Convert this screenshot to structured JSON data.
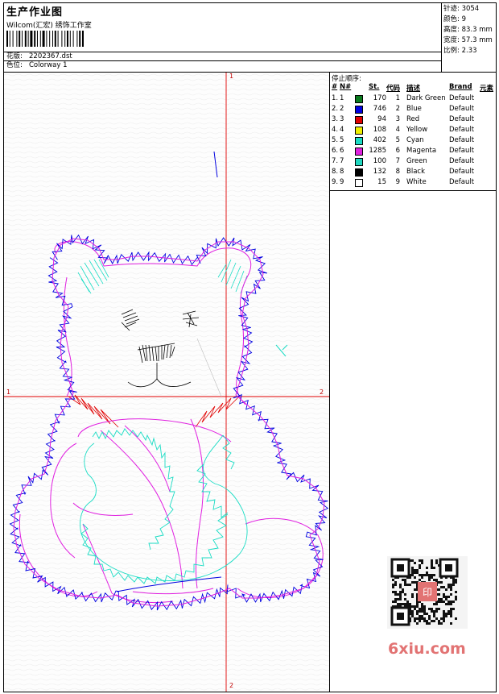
{
  "header": {
    "title": "生产作业图",
    "company": "Wilcom(汇宏) 绣饰工作室",
    "design_label": "花版:",
    "design_value": "2202367.dst",
    "colorway_label": "色位:",
    "colorway_value": "Colorway 1"
  },
  "stats": [
    {
      "label": "针迹:",
      "value": "3054"
    },
    {
      "label": "颜色:",
      "value": "9"
    },
    {
      "label": "高度:",
      "value": "83.3 mm"
    },
    {
      "label": "宽度:",
      "value": "57.3 mm"
    },
    {
      "label": "比例:",
      "value": "2.33"
    }
  ],
  "sequence": {
    "title": "停止顺序:",
    "headers": {
      "num": "#",
      "n": "N#",
      "st": "St.",
      "code": "代码",
      "desc": "描述",
      "brand": "Brand",
      "elem": "元素"
    },
    "rows": [
      {
        "num": "1.",
        "n": "1",
        "color": "#0a7a1e",
        "st": "170",
        "code": "1",
        "desc": "Dark Green",
        "brand": "Default"
      },
      {
        "num": "2.",
        "n": "2",
        "color": "#0000e0",
        "st": "746",
        "code": "2",
        "desc": "Blue",
        "brand": "Default"
      },
      {
        "num": "3.",
        "n": "3",
        "color": "#e00000",
        "st": "94",
        "code": "3",
        "desc": "Red",
        "brand": "Default"
      },
      {
        "num": "4.",
        "n": "4",
        "color": "#f0f000",
        "st": "108",
        "code": "4",
        "desc": "Yellow",
        "brand": "Default"
      },
      {
        "num": "5.",
        "n": "5",
        "color": "#1adcc4",
        "st": "402",
        "code": "5",
        "desc": "Cyan",
        "brand": "Default"
      },
      {
        "num": "6.",
        "n": "6",
        "color": "#e020e0",
        "st": "1285",
        "code": "6",
        "desc": "Magenta",
        "brand": "Default"
      },
      {
        "num": "7.",
        "n": "7",
        "color": "#20d8c0",
        "st": "100",
        "code": "7",
        "desc": "Green",
        "brand": "Default"
      },
      {
        "num": "8.",
        "n": "8",
        "color": "#000000",
        "st": "132",
        "code": "8",
        "desc": "Black",
        "brand": "Default"
      },
      {
        "num": "9.",
        "n": "9",
        "color": "#ffffff",
        "st": "15",
        "code": "9",
        "desc": "White",
        "brand": "Default"
      }
    ]
  },
  "preview": {
    "axis_labels": {
      "v_top": "1",
      "v_bottom": "2",
      "h_left": "1",
      "h_right": "2"
    },
    "image": "teddy-bear-embroidery-outline"
  },
  "watermark": {
    "text": "6xiu.com",
    "qr": "qr-code",
    "stamp_text": "印"
  }
}
